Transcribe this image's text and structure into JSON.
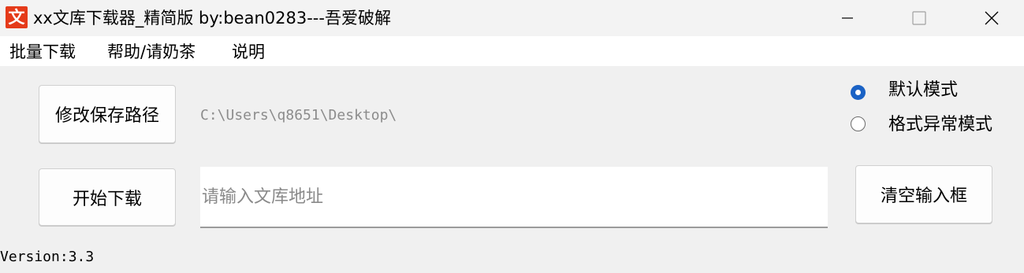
{
  "window": {
    "icon_glyph": "文",
    "title": "xx文库下载器_精简版  by:bean0283---吾爱破解"
  },
  "menu": {
    "items": [
      "批量下载",
      "帮助/请奶茶",
      "说明"
    ]
  },
  "buttons": {
    "change_path": "修改保存路径",
    "start_download": "开始下载",
    "clear_input": "清空输入框"
  },
  "save_path": "C:\\Users\\q8651\\Desktop\\",
  "url_input": {
    "value": "",
    "placeholder": "请输入文库地址"
  },
  "modes": {
    "default_mode": "默认模式",
    "format_error_mode": "格式异常模式",
    "selected": "默认模式"
  },
  "version": "Version:3.3",
  "colors": {
    "app_icon": "#e53b1a",
    "radio_selected": "#1a62c5"
  }
}
